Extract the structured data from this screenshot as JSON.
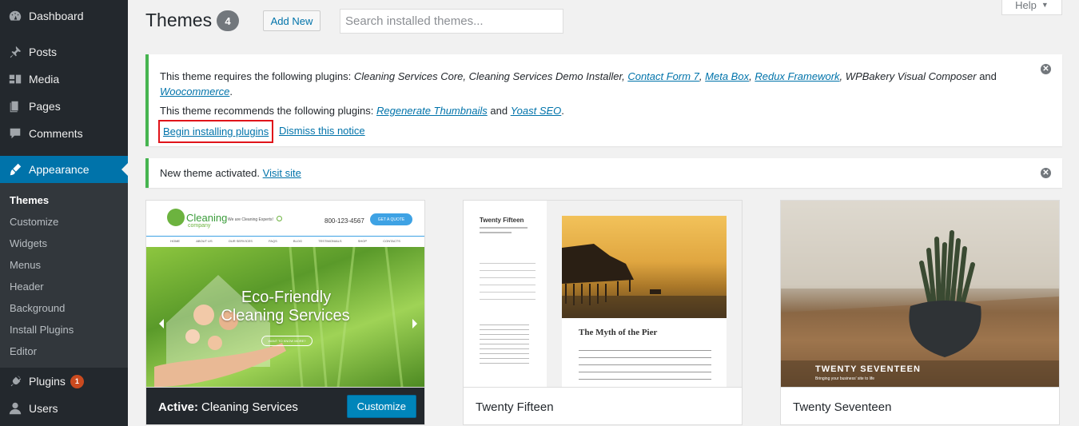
{
  "sidebar": {
    "items": [
      {
        "label": "Dashboard",
        "icon": "dashboard-icon"
      },
      {
        "label": "Posts",
        "icon": "pin-icon"
      },
      {
        "label": "Media",
        "icon": "media-icon"
      },
      {
        "label": "Pages",
        "icon": "pages-icon"
      },
      {
        "label": "Comments",
        "icon": "comment-icon"
      },
      {
        "label": "Appearance",
        "icon": "brush-icon"
      },
      {
        "label": "Plugins",
        "icon": "plug-icon",
        "badge": "1"
      },
      {
        "label": "Users",
        "icon": "user-icon"
      }
    ],
    "submenu": [
      "Themes",
      "Customize",
      "Widgets",
      "Menus",
      "Header",
      "Background",
      "Install Plugins",
      "Editor"
    ]
  },
  "header": {
    "title": "Themes",
    "count": "4",
    "add_new": "Add New",
    "search_placeholder": "Search installed themes...",
    "help": "Help"
  },
  "notice_plugins": {
    "req_intro": "This theme requires the following plugins:",
    "req_plain1": "Cleaning Services Core, Cleaning Services Demo Installer,",
    "req_link1": "Contact Form 7",
    "req_link2": "Meta Box",
    "req_link3": "Redux Framework",
    "req_plain2": "WPBakery Visual Composer",
    "req_and": "and",
    "req_link4": "Woocommerce",
    "rec_intro": "This theme recommends the following plugins:",
    "rec_link1": "Regenerate Thumbnails",
    "rec_and": "and",
    "rec_link2": "Yoast SEO",
    "begin": "Begin installing plugins",
    "dismiss": "Dismiss this notice"
  },
  "notice_activated": {
    "text": "New theme activated.",
    "link": "Visit site"
  },
  "themes": [
    {
      "active_prefix": "Active:",
      "name": "Cleaning Services",
      "customize": "Customize",
      "preview": {
        "logo": "Cleaning",
        "logo_sub": "company",
        "tagline": "We are Cleaning Experts!",
        "phone": "800-123-4567",
        "cta": "GET A QUOTE",
        "nav": [
          "HOME",
          "ABOUT US",
          "OUR SERVICES",
          "FAQS",
          "BLOG",
          "TESTIMONIALS",
          "SHOP",
          "CONTACTS"
        ],
        "hero_line1": "Eco-Friendly",
        "hero_line2": "Cleaning Services",
        "hero_button": "WANT TO KNOW MORE?"
      }
    },
    {
      "name": "Twenty Fifteen",
      "preview": {
        "site_title": "Twenty Fifteen",
        "post_title": "The Myth of the Pier"
      }
    },
    {
      "name": "Twenty Seventeen",
      "preview": {
        "site_title": "TWENTY SEVENTEEN",
        "tagline": "Bringing your business' site to life"
      }
    }
  ]
}
